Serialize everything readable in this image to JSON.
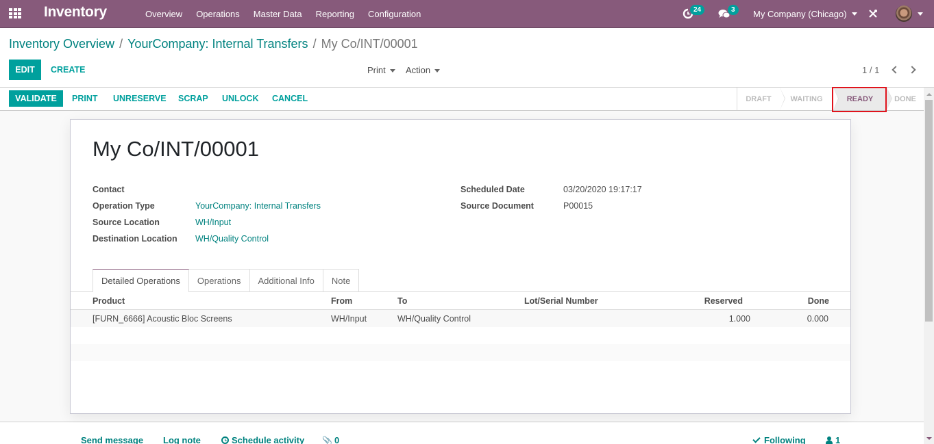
{
  "navbar": {
    "app_title": "Inventory",
    "menu": [
      "Overview",
      "Operations",
      "Master Data",
      "Reporting",
      "Configuration"
    ],
    "activity_count": "24",
    "message_count": "3",
    "company": "My Company (Chicago)",
    "icons": {
      "apps": "apps-grid-icon",
      "activity": "clock-icon",
      "messages": "chat-bubbles-icon",
      "debug": "tools-icon",
      "avatar": "user-avatar"
    }
  },
  "breadcrumb": {
    "items": [
      "Inventory Overview",
      "YourCompany: Internal Transfers"
    ],
    "current": "My Co/INT/00001",
    "separator": "/"
  },
  "control_panel": {
    "edit_label": "EDIT",
    "create_label": "CREATE",
    "print_label": "Print",
    "action_label": "Action",
    "pager": "1 / 1"
  },
  "header": {
    "buttons": [
      "VALIDATE",
      "PRINT",
      "UNRESERVE",
      "SCRAP",
      "UNLOCK",
      "CANCEL"
    ],
    "stages": [
      "DRAFT",
      "WAITING",
      "READY",
      "DONE"
    ],
    "current_stage": "READY"
  },
  "form": {
    "title": "My Co/INT/00001",
    "left_fields": [
      {
        "label": "Contact",
        "value": ""
      },
      {
        "label": "Operation Type",
        "value": "YourCompany: Internal Transfers"
      },
      {
        "label": "Source Location",
        "value": "WH/Input"
      },
      {
        "label": "Destination Location",
        "value": "WH/Quality Control"
      }
    ],
    "right_fields": [
      {
        "label": "Scheduled Date",
        "value": "03/20/2020 19:17:17"
      },
      {
        "label": "Source Document",
        "value": "P00015"
      }
    ],
    "tabs": [
      "Detailed Operations",
      "Operations",
      "Additional Info",
      "Note"
    ],
    "active_tab": "Detailed Operations",
    "table": {
      "columns": [
        "Product",
        "From",
        "To",
        "Lot/Serial Number",
        "Reserved",
        "Done"
      ],
      "rows": [
        {
          "product": "[FURN_6666] Acoustic Bloc Screens",
          "from": "WH/Input",
          "to": "WH/Quality Control",
          "lot": "",
          "reserved": "1.000",
          "done": "0.000"
        }
      ]
    }
  },
  "chatter": {
    "send_message": "Send message",
    "log_note": "Log note",
    "schedule_activity": "Schedule activity",
    "attachments": "0",
    "following": "Following",
    "followers": "1"
  },
  "colors": {
    "brand": "#875a7b",
    "accent": "#00a09d",
    "link": "#00827f",
    "highlight": "#e0131c"
  }
}
